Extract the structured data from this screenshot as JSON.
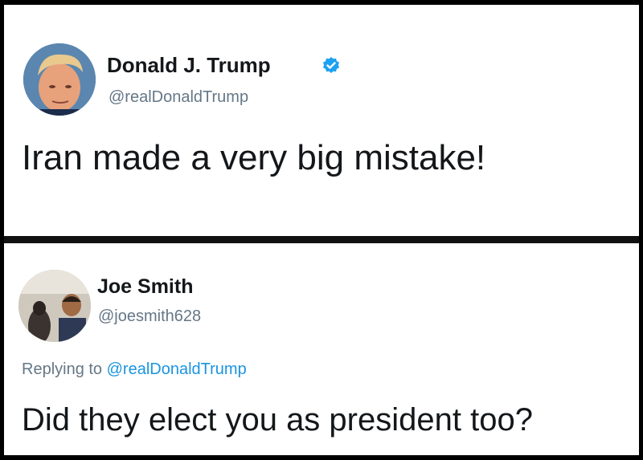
{
  "tweet": {
    "author_name": "Donald J. Trump",
    "author_handle": "@realDonaldTrump",
    "verified": true,
    "text": "Iran made a very big mistake!"
  },
  "reply": {
    "author_name": "Joe Smith",
    "author_handle": "@joesmith628",
    "replying_prefix": "Replying to",
    "replying_to": "@realDonaldTrump",
    "text": "Did they elect you as president too?"
  },
  "colors": {
    "verified_badge": "#1da1f2",
    "mention": "#1b95e0",
    "handle": "#657786",
    "text": "#14171a"
  },
  "icons": {
    "verified": "verified-badge-icon",
    "avatar_trump": "avatar",
    "avatar_joe": "avatar"
  }
}
